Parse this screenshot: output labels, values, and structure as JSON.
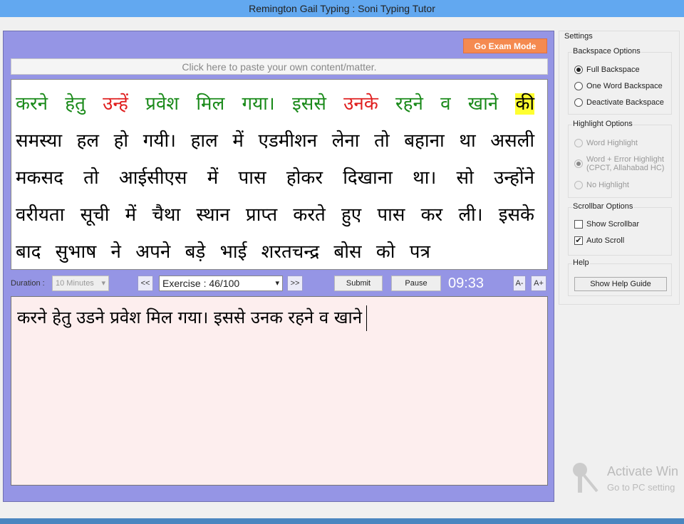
{
  "window": {
    "title": "Remington Gail Typing : Soni Typing Tutor"
  },
  "toolbar": {
    "exam_mode": "Go Exam Mode",
    "paste_hint": "Click here to paste your own content/matter."
  },
  "passage": {
    "words": [
      {
        "t": "करने",
        "s": "ok"
      },
      {
        "t": "हेतु",
        "s": "ok"
      },
      {
        "t": "उन्हें",
        "s": "err"
      },
      {
        "t": "प्रवेश",
        "s": "ok"
      },
      {
        "t": "मिल",
        "s": "ok"
      },
      {
        "t": "गया।",
        "s": "ok"
      },
      {
        "t": "इससे",
        "s": "ok"
      },
      {
        "t": "उनके",
        "s": "err"
      },
      {
        "t": "रहने",
        "s": "ok"
      },
      {
        "t": "व",
        "s": "ok"
      },
      {
        "t": "खाने",
        "s": "ok"
      },
      {
        "t": "की",
        "s": "cur"
      },
      {
        "t": "समस्या",
        "s": "pend"
      },
      {
        "t": "हल",
        "s": "pend"
      },
      {
        "t": "हो",
        "s": "pend"
      },
      {
        "t": "गयी।",
        "s": "pend"
      },
      {
        "t": "हाल",
        "s": "pend"
      },
      {
        "t": "में",
        "s": "pend"
      },
      {
        "t": "एडमीशन",
        "s": "pend"
      },
      {
        "t": "लेना",
        "s": "pend"
      },
      {
        "t": "तो",
        "s": "pend"
      },
      {
        "t": "बहाना",
        "s": "pend"
      },
      {
        "t": "था",
        "s": "pend"
      },
      {
        "t": "असली",
        "s": "pend"
      },
      {
        "t": "मकसद",
        "s": "pend"
      },
      {
        "t": "तो",
        "s": "pend"
      },
      {
        "t": "आईसीएस",
        "s": "pend"
      },
      {
        "t": "में",
        "s": "pend"
      },
      {
        "t": "पास",
        "s": "pend"
      },
      {
        "t": "होकर",
        "s": "pend"
      },
      {
        "t": "दिखाना",
        "s": "pend"
      },
      {
        "t": "था।",
        "s": "pend"
      },
      {
        "t": "सो",
        "s": "pend"
      },
      {
        "t": "उन्होंने",
        "s": "pend"
      },
      {
        "t": "वरीयता",
        "s": "pend"
      },
      {
        "t": "सूची",
        "s": "pend"
      },
      {
        "t": "में",
        "s": "pend"
      },
      {
        "t": "चैथा",
        "s": "pend"
      },
      {
        "t": "स्थान",
        "s": "pend"
      },
      {
        "t": "प्राप्त",
        "s": "pend"
      },
      {
        "t": "करते",
        "s": "pend"
      },
      {
        "t": "हुए",
        "s": "pend"
      },
      {
        "t": "पास",
        "s": "pend"
      },
      {
        "t": "कर",
        "s": "pend"
      },
      {
        "t": "ली।",
        "s": "pend"
      },
      {
        "t": "इसके",
        "s": "pend"
      },
      {
        "t": "बाद",
        "s": "pend"
      },
      {
        "t": "सुभाष",
        "s": "pend"
      },
      {
        "t": "ने",
        "s": "pend"
      },
      {
        "t": "अपने",
        "s": "pend"
      },
      {
        "t": "बड़े",
        "s": "pend"
      },
      {
        "t": "भाई",
        "s": "pend"
      },
      {
        "t": "शरतचन्द्र",
        "s": "pend"
      },
      {
        "t": "बोस",
        "s": "pend"
      },
      {
        "t": "को",
        "s": "pend"
      },
      {
        "t": "पत्र",
        "s": "pend"
      }
    ],
    "colors": {
      "correct": "#1a8a1a",
      "error": "#e02020",
      "current_highlight": "#ffff30"
    }
  },
  "controls": {
    "duration_label": "Duration :",
    "duration_value": "10 Minutes",
    "prev": "<<",
    "exercise": "Exercise : 46/100",
    "next": ">>",
    "submit": "Submit",
    "pause": "Pause",
    "timer": "09:33",
    "font_down": "A-",
    "font_up": "A+"
  },
  "typed": {
    "text": "करने हेतु उडने प्रवेश मिल गया। इससे उनक रहने व खाने"
  },
  "settings": {
    "title": "Settings",
    "backspace": {
      "title": "Backspace Options",
      "options": [
        "Full Backspace",
        "One Word Backspace",
        "Deactivate Backspace"
      ],
      "selected": "Full Backspace"
    },
    "highlight": {
      "title": "Highlight Options",
      "options": [
        "Word Highlight",
        "Word + Error Highlight",
        "No Highlight"
      ],
      "option2_sub": "(CPCT, Allahabad HC)",
      "selected": "Word + Error Highlight",
      "disabled": true
    },
    "scrollbar": {
      "title": "Scrollbar Options",
      "show_scrollbar": {
        "label": "Show Scrollbar",
        "checked": false
      },
      "auto_scroll": {
        "label": "Auto Scroll",
        "checked": true
      }
    },
    "help": {
      "title": "Help",
      "button": "Show Help Guide"
    }
  },
  "watermark": {
    "line1": "Activate Win",
    "line2": "Go to PC setting"
  }
}
